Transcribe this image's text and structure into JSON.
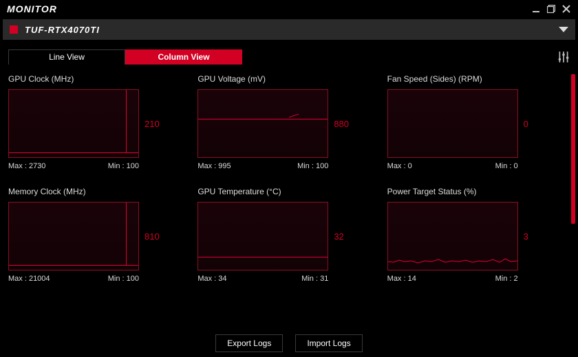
{
  "header": {
    "app_title": "MONITOR",
    "device_name": "TUF-RTX4070TI"
  },
  "tabs": {
    "line_view_label": "Line View",
    "column_view_label": "Column View",
    "active": "column"
  },
  "footer": {
    "export_label": "Export Logs",
    "import_label": "Import Logs"
  },
  "colors": {
    "accent": "#d20023",
    "panel_bg": "#000000",
    "device_bar": "#2a2a2a"
  },
  "chart_data": [
    {
      "id": "gpu_clock",
      "title": "GPU Clock (MHz)",
      "type": "line",
      "current": 210,
      "max_label": "Max : 2730",
      "min_label": "Min : 100",
      "max": 2730,
      "min": 100,
      "ylim": [
        0,
        3000
      ],
      "shape": "flat_low_with_single_spike",
      "series": [
        {
          "name": "gpu_clock_mhz",
          "approx_values": [
            100,
            100,
            100,
            100,
            100,
            100,
            100,
            100,
            100,
            2730,
            100
          ]
        }
      ]
    },
    {
      "id": "gpu_voltage",
      "title": "GPU Voltage (mV)",
      "type": "line",
      "current": 880,
      "max_label": "Max : 995",
      "min_label": "Min : 100",
      "max": 995,
      "min": 100,
      "ylim": [
        0,
        1100
      ],
      "shape": "steady_mid_with_small_bump",
      "series": [
        {
          "name": "gpu_voltage_mv",
          "approx_values": [
            880,
            880,
            880,
            880,
            880,
            880,
            880,
            920,
            880,
            880,
            880
          ]
        }
      ]
    },
    {
      "id": "fan_speed",
      "title": "Fan Speed (Sides) (RPM)",
      "type": "line",
      "current": 0,
      "max_label": "Max : 0",
      "min_label": "Min : 0",
      "max": 0,
      "min": 0,
      "ylim": [
        0,
        100
      ],
      "shape": "empty",
      "series": [
        {
          "name": "fan_rpm",
          "approx_values": [
            0,
            0,
            0,
            0,
            0,
            0,
            0,
            0,
            0,
            0,
            0
          ]
        }
      ]
    },
    {
      "id": "mem_clock",
      "title": "Memory Clock (MHz)",
      "type": "line",
      "current": 810,
      "max_label": "Max : 21004",
      "min_label": "Min : 100",
      "max": 21004,
      "min": 100,
      "ylim": [
        0,
        22000
      ],
      "shape": "flat_low_with_single_spike",
      "series": [
        {
          "name": "mem_clock_mhz",
          "approx_values": [
            100,
            100,
            100,
            100,
            100,
            100,
            100,
            100,
            100,
            21004,
            100
          ]
        }
      ]
    },
    {
      "id": "gpu_temp",
      "title": "GPU Temperature (°C)",
      "type": "line",
      "current": 32,
      "max_label": "Max : 34",
      "min_label": "Min : 31",
      "max": 34,
      "min": 31,
      "ylim": [
        0,
        100
      ],
      "shape": "flat_low_line",
      "series": [
        {
          "name": "gpu_temp_c",
          "approx_values": [
            32,
            32,
            32,
            32,
            32,
            32,
            32,
            32,
            32,
            32,
            32
          ]
        }
      ]
    },
    {
      "id": "power_target",
      "title": "Power Target Status (%)",
      "type": "line",
      "current": 3,
      "max_label": "Max : 14",
      "min_label": "Min : 2",
      "max": 14,
      "min": 2,
      "ylim": [
        0,
        100
      ],
      "shape": "noisy_low",
      "series": [
        {
          "name": "power_target_pct",
          "approx_values": [
            3,
            4,
            2,
            3,
            5,
            3,
            2,
            4,
            3,
            6,
            3
          ]
        }
      ]
    }
  ]
}
